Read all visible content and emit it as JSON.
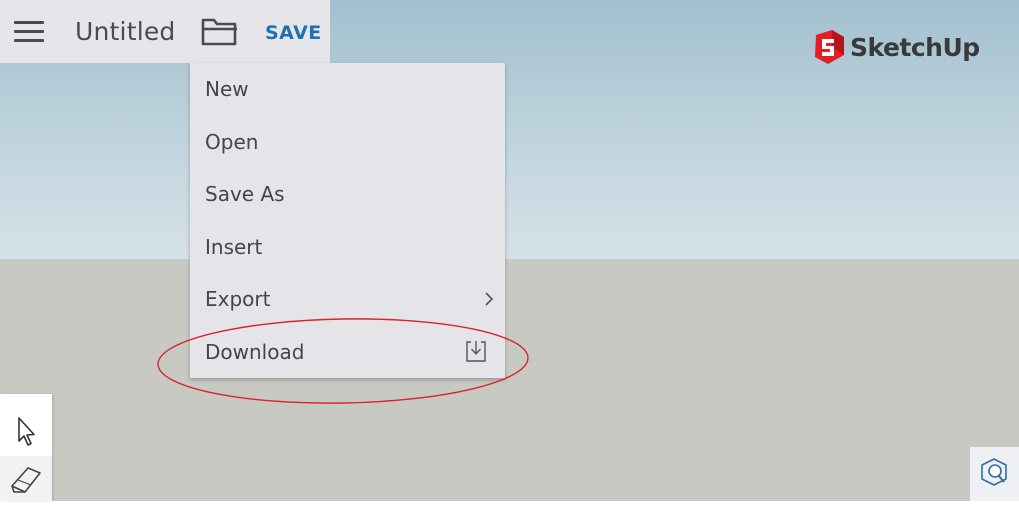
{
  "toolbar": {
    "doc_title": "Untitled",
    "save_label": "SAVE"
  },
  "brand": {
    "logo_text": "SketchUp",
    "logo_color": "#e31e24"
  },
  "file_menu": {
    "items": [
      {
        "label": "New"
      },
      {
        "label": "Open"
      },
      {
        "label": "Save As"
      },
      {
        "label": "Insert"
      },
      {
        "label": "Export",
        "has_submenu": true
      },
      {
        "label": "Download",
        "icon": "download-icon"
      }
    ]
  },
  "annotation": {
    "highlighted_item": "Download",
    "color": "#d9252a"
  },
  "icons": {
    "menu": "hamburger-menu-icon",
    "open": "folder-open-icon",
    "select_tool": "cursor-arrow-icon",
    "eraser_tool": "eraser-icon",
    "search": "search-cube-icon"
  },
  "colors": {
    "accent": "#1f6fb3",
    "sky": "#a2c0cf",
    "ground": "#c9c9c4",
    "menu_bg": "#e5e4e9"
  }
}
